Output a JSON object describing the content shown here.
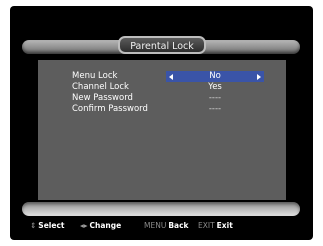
{
  "title": "Parental Lock",
  "menu": [
    {
      "label": "Menu Lock",
      "value": "No"
    },
    {
      "label": "Channel Lock",
      "value": "Yes"
    },
    {
      "label": "New Password",
      "value": "----"
    },
    {
      "label": "Confirm Password",
      "value": "----"
    }
  ],
  "footer": {
    "select": {
      "icon": "⇕",
      "label": "Select"
    },
    "change": {
      "icon": "◂▸",
      "label": "Change"
    },
    "back": {
      "key": "MENU",
      "label": "Back"
    },
    "exit": {
      "key": "EXIT",
      "label": "Exit"
    }
  }
}
